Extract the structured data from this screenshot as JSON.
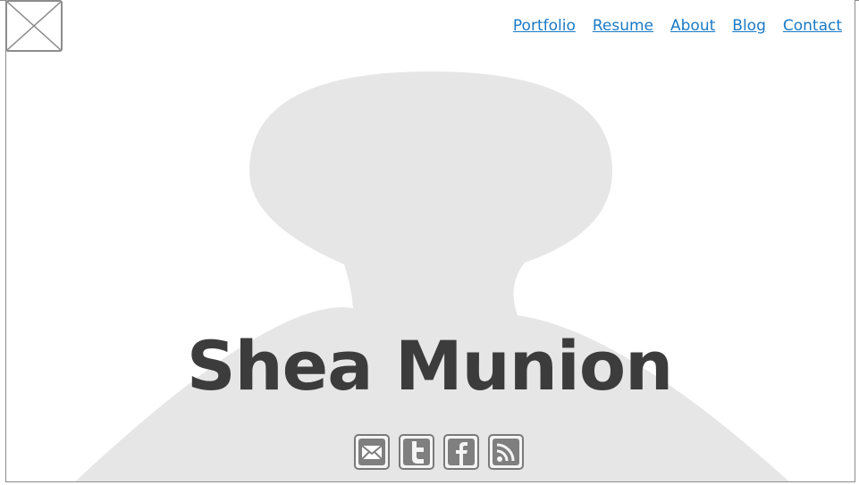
{
  "nav": {
    "items": [
      {
        "label": "Portfolio"
      },
      {
        "label": "Resume"
      },
      {
        "label": "About"
      },
      {
        "label": "Blog"
      },
      {
        "label": "Contact"
      }
    ]
  },
  "hero": {
    "name": "Shea Munion"
  },
  "social": {
    "icons": [
      "mail-icon",
      "twitter-icon",
      "facebook-icon",
      "rss-icon"
    ]
  },
  "colors": {
    "link": "#1a7ac6",
    "title": "#3c3c3c",
    "silhouette": "#e6e6e6",
    "border": "#8c8c8c"
  },
  "icons": {
    "logo": "image-placeholder-icon",
    "silhouette": "person-silhouette"
  }
}
